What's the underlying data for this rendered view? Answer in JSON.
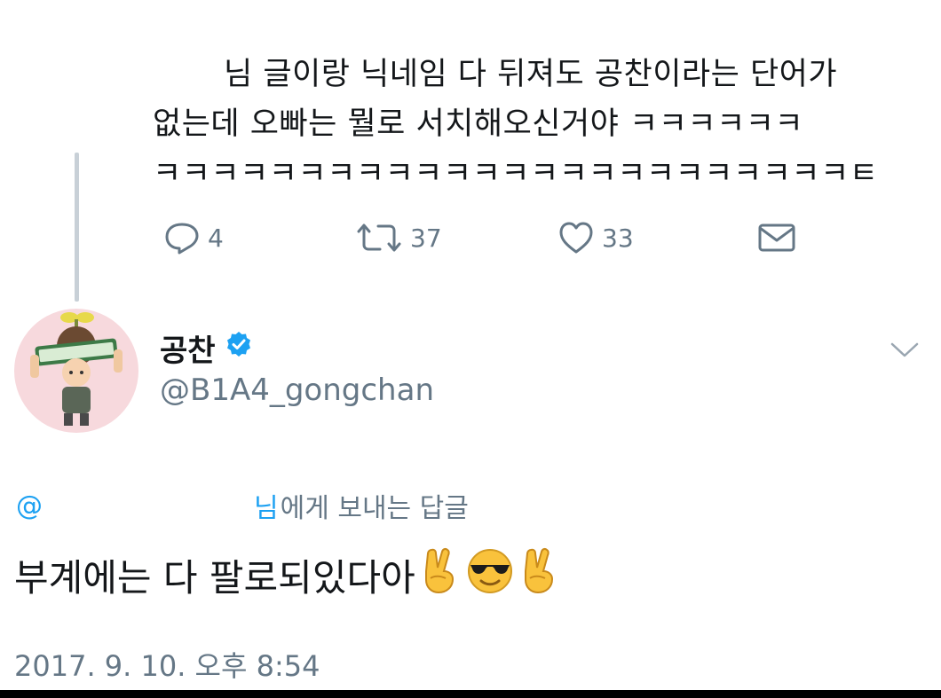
{
  "parent_tweet": {
    "lines": [
      "님 글이랑 닉네임 다 뒤져도 공찬이라는 단어가",
      "없는데 오빠는 뭘로 서치해오신거야 ㅋㅋㅋㅋㅋㅋ",
      "ㅋㅋㅋㅋㅋㅋㅋㅋㅋㅋㅋㅋㅋㅋㅋㅋㅋㅋㅋㅋㅋㅋㅋㅋㅌ"
    ],
    "actions": {
      "reply_count": "4",
      "retweet_count": "37",
      "like_count": "33"
    }
  },
  "reply_tweet": {
    "display_name": "공찬",
    "verified": true,
    "handle": "@B1A4_gongchan",
    "reply_to": {
      "at_sign": "@",
      "partial_name": "님",
      "suffix": "에게 보내는 답글"
    },
    "text": "부계에는 다 팔로되있다아",
    "emojis": [
      "victory-hand",
      "smiling-face-with-sunglasses",
      "victory-hand"
    ],
    "timestamp": "2017. 9. 10. 오후 8:54"
  },
  "colors": {
    "text_primary": "#14171a",
    "text_secondary": "#657786",
    "accent": "#1da1f2",
    "thread_line": "#c8d0d7"
  }
}
